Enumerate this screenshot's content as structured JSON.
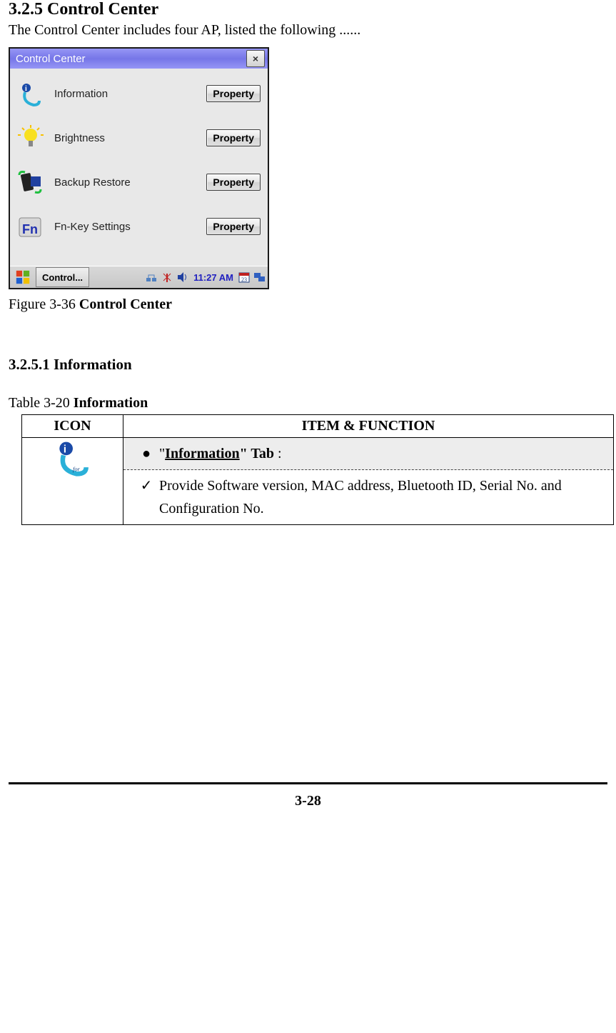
{
  "section": {
    "heading": "3.2.5 Control Center",
    "intro": "The Control Center includes four AP, listed the following ......"
  },
  "screenshot": {
    "title": "Control Center",
    "close": "×",
    "rows": [
      {
        "label": "Information",
        "button": "Property",
        "iconName": "info-icon"
      },
      {
        "label": "Brightness",
        "button": "Property",
        "iconName": "brightness-icon"
      },
      {
        "label": "Backup Restore",
        "button": "Property",
        "iconName": "backup-icon"
      },
      {
        "label": "Fn-Key Settings",
        "button": "Property",
        "iconName": "fnkey-icon"
      }
    ],
    "taskbar": {
      "startIcon": "windows-start-icon",
      "task": "Control...",
      "time": "11:27 AM",
      "trayIcons": [
        "network-icon",
        "antenna-icon",
        "volume-icon",
        "calendar-icon",
        "screens-icon"
      ]
    }
  },
  "figure": {
    "label": "Figure 3-36 ",
    "title": "Control Center"
  },
  "subsection": {
    "heading": "3.2.5.1 Information"
  },
  "tableCaption": {
    "label": "Table 3-20 ",
    "title": "Information"
  },
  "table": {
    "headers": {
      "icon": "ICON",
      "item": "ITEM & FUNCTION"
    },
    "tabRow": {
      "prefix": "\"",
      "name": "Information",
      "suffix": "\" Tab",
      "colon": " :"
    },
    "detailRow": "Provide Software version, MAC address, Bluetooth ID, Serial No. and Configuration No.",
    "iconName": "info-large-icon"
  },
  "pageNumber": "3-28"
}
